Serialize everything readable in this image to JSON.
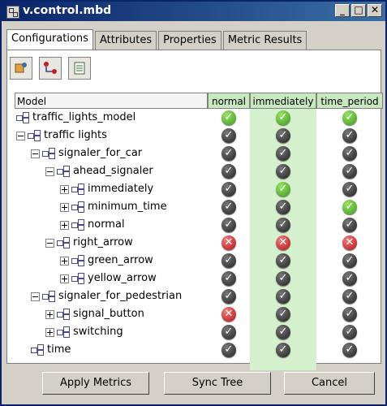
{
  "window": {
    "title": "v.control.mbd",
    "buttons": [
      "_",
      "□",
      "✕"
    ]
  },
  "tabs": [
    "Configurations",
    "Attributes",
    "Properties",
    "Metric Results"
  ],
  "toolbar": {
    "icons": [
      "config-icon",
      "tree-icon",
      "list-icon"
    ]
  },
  "table": {
    "headers": {
      "model": "Model",
      "normal": "normal",
      "immediately": "immediately",
      "time_period": "time_period"
    },
    "rows": [
      {
        "label": "traffic_lights_model",
        "depth": 0,
        "expander": "none",
        "status": [
          "ok",
          "ok",
          "ok"
        ]
      },
      {
        "label": "traffic lights",
        "depth": 0,
        "expander": "minus",
        "status": [
          "dark",
          "dark",
          "dark"
        ]
      },
      {
        "label": "signaler_for_car",
        "depth": 1,
        "expander": "minus",
        "status": [
          "dark",
          "dark",
          "dark"
        ]
      },
      {
        "label": "ahead_signaler",
        "depth": 2,
        "expander": "minus",
        "status": [
          "dark",
          "dark",
          "dark"
        ]
      },
      {
        "label": "immediately",
        "depth": 3,
        "expander": "plus",
        "status": [
          "dark",
          "ok",
          "dark"
        ]
      },
      {
        "label": "minimum_time",
        "depth": 3,
        "expander": "plus",
        "status": [
          "dark",
          "dark",
          "ok"
        ]
      },
      {
        "label": "normal",
        "depth": 3,
        "expander": "plus",
        "status": [
          "dark",
          "dark",
          "dark"
        ]
      },
      {
        "label": "right_arrow",
        "depth": 2,
        "expander": "minus",
        "status": [
          "bad",
          "bad",
          "bad"
        ]
      },
      {
        "label": "green_arrow",
        "depth": 3,
        "expander": "plus",
        "status": [
          "dark",
          "dark",
          "dark"
        ]
      },
      {
        "label": "yellow_arrow",
        "depth": 3,
        "expander": "plus",
        "status": [
          "dark",
          "dark",
          "dark"
        ]
      },
      {
        "label": "signaler_for_pedestrian",
        "depth": 1,
        "expander": "minus",
        "status": [
          "dark",
          "dark",
          "dark"
        ]
      },
      {
        "label": "signal_button",
        "depth": 2,
        "expander": "plus",
        "status": [
          "bad",
          "dark",
          "dark"
        ]
      },
      {
        "label": "switching",
        "depth": 2,
        "expander": "plus",
        "status": [
          "dark",
          "dark",
          "dark"
        ]
      },
      {
        "label": "time",
        "depth": 1,
        "expander": "none",
        "status": [
          "dark",
          "dark",
          "dark"
        ]
      }
    ]
  },
  "buttons": {
    "apply": "Apply Metrics",
    "sync": "Sync Tree",
    "cancel": "Cancel"
  },
  "colors": {
    "accent": "#0a246a",
    "highlight": "#d4f0cc",
    "ok": "#3a9c1a",
    "bad": "#b01010",
    "neutral": "#222222"
  }
}
